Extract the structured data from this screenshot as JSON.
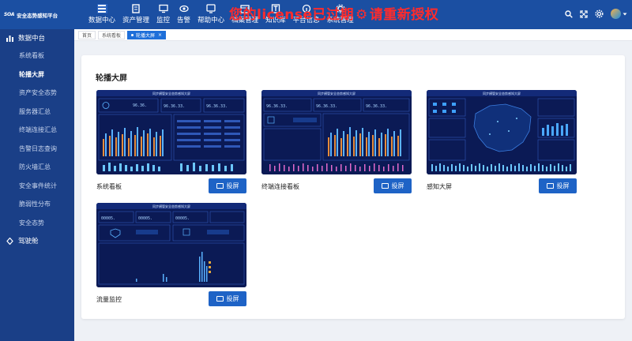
{
  "app": {
    "logo_mark": "SOA",
    "title": "安全态势感知平台"
  },
  "nav": [
    {
      "label": "数据中心",
      "icon": "data-center-icon"
    },
    {
      "label": "资产管理",
      "icon": "asset-icon"
    },
    {
      "label": "监控",
      "icon": "monitor-icon"
    },
    {
      "label": "告警",
      "icon": "alarm-icon"
    },
    {
      "label": "帮助中心",
      "icon": "help-icon"
    },
    {
      "label": "档案管理",
      "icon": "archive-icon"
    },
    {
      "label": "知识库",
      "icon": "knowledge-icon"
    },
    {
      "label": "平台信息",
      "icon": "platform-icon"
    },
    {
      "label": "系统管理",
      "icon": "system-icon"
    }
  ],
  "license_banner": {
    "before": "您的license已过期",
    "after": "请重新授权"
  },
  "sidebar": {
    "header": "数据中台",
    "items": [
      "系统看板",
      "轮播大屏",
      "资产安全态势",
      "服务器汇总",
      "终端连接汇总",
      "告警日志查询",
      "防火墙汇总",
      "安全事件统计",
      "脆弱性分布",
      "安全态势"
    ],
    "footer": "驾驶舱"
  },
  "tabs": [
    {
      "label": "首页"
    },
    {
      "label": "系统看板"
    },
    {
      "label": "轮播大屏",
      "close": "×"
    }
  ],
  "panel": {
    "title": "轮播大屏",
    "cast_label": "投屏"
  },
  "cards": [
    {
      "name": "系统看板",
      "screen_title": "同步横管安全态势感知大屏",
      "readout_a": "96.36.",
      "readout_b": "96.36.33.",
      "readout_c": "96.36.33."
    },
    {
      "name": "终端连接看板",
      "screen_title": "同步横管安全态势感知大屏",
      "readout_a": "96.36.33.",
      "readout_b": "96.36.33.",
      "readout_c": "96.36.33."
    },
    {
      "name": "感知大屏",
      "screen_title": "同步横管安全态势感知大屏",
      "readout_a": "",
      "readout_b": "",
      "readout_c": ""
    },
    {
      "name": "流量监控",
      "screen_title": "同步横管安全态势感知大屏",
      "readout_a": "00005.",
      "readout_b": "00005.",
      "readout_c": "00005."
    }
  ],
  "colors": {
    "topbar": "#1b4fa2",
    "sidebar": "#1a3f87",
    "accent": "#1e63c6",
    "banner": "#ff2b2b",
    "screen_bg": "#0b1a55"
  }
}
